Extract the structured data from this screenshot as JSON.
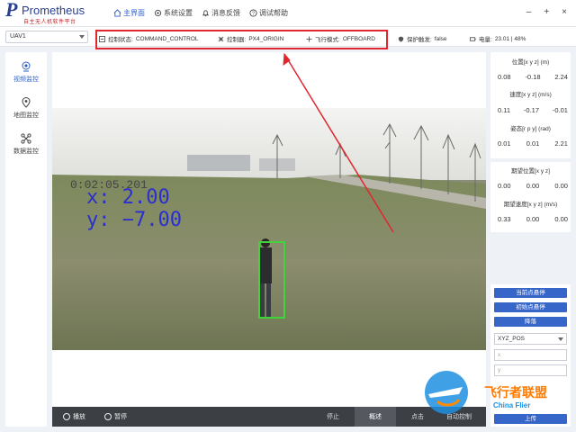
{
  "app": {
    "logo_main": "Prometheus",
    "logo_sub": "自主无人机软件平台"
  },
  "nav": [
    {
      "label": "主界面",
      "icon": "home-icon"
    },
    {
      "label": "系统设置",
      "icon": "settings-icon"
    },
    {
      "label": "消息反馈",
      "icon": "bell-icon"
    },
    {
      "label": "调试帮助",
      "icon": "help-icon"
    }
  ],
  "window_controls": {
    "minimize": "–",
    "add": "+",
    "close": "×"
  },
  "statusbar": {
    "uav_select": "UAV1",
    "control_state_label": "控制状态:",
    "control_state_value": "COMMAND_CONTROL",
    "controller_label": "控制器:",
    "controller_value": "PX4_ORIGIN",
    "flight_mode_label": "飞行模式:",
    "flight_mode_value": "OFFBOARD",
    "protect_label": "保护触发:",
    "protect_value": "false",
    "battery_label": "电量:",
    "battery_value": "23.01 | 48%"
  },
  "sidebar": [
    {
      "label": "视频监控",
      "icon": "camera-icon"
    },
    {
      "label": "地图监控",
      "icon": "map-pin-icon"
    },
    {
      "label": "数据监控",
      "icon": "drone-icon"
    }
  ],
  "video": {
    "timestamp": "0:02:05.201",
    "x_text": "x:  2.00",
    "y_text": "y: −7.00"
  },
  "player_controls": {
    "play": "播放",
    "pause": "暂停",
    "tabs": [
      "停止",
      "概述",
      "点击",
      "自动控制"
    ]
  },
  "state_panel": {
    "position_title": "位置[x y z] (m)",
    "position": [
      "0.08",
      "-0.18",
      "2.24"
    ],
    "velocity_title": "速度[x y z] (m/s)",
    "velocity": [
      "0.11",
      "-0.17",
      "-0.01"
    ],
    "attitude_title": "姿态[r p y] (rad)",
    "attitude": [
      "0.01",
      "0.01",
      "2.21"
    ]
  },
  "desired_panel": {
    "des_pos_title": "期望位置[x y z]",
    "des_pos": [
      "0.00",
      "0.00",
      "0.00"
    ],
    "des_vel_title": "期望速度[x y z] (m/s)",
    "des_vel": [
      "0.33",
      "0.00",
      "0.00"
    ]
  },
  "command_panel": {
    "hover_current": "当前点悬停",
    "hover_init": "初始点悬停",
    "land": "降落",
    "mode_select": "XYZ_POS",
    "x_placeholder": "x",
    "y_placeholder": "y",
    "upload": "上传"
  },
  "watermark": {
    "text": "飞行者联盟",
    "sub": "China Flier"
  },
  "colors": {
    "accent": "#3766c9",
    "highlight": "#e0272e",
    "bbox": "#3ed43a",
    "overlay_text": "#2a2fd0"
  }
}
